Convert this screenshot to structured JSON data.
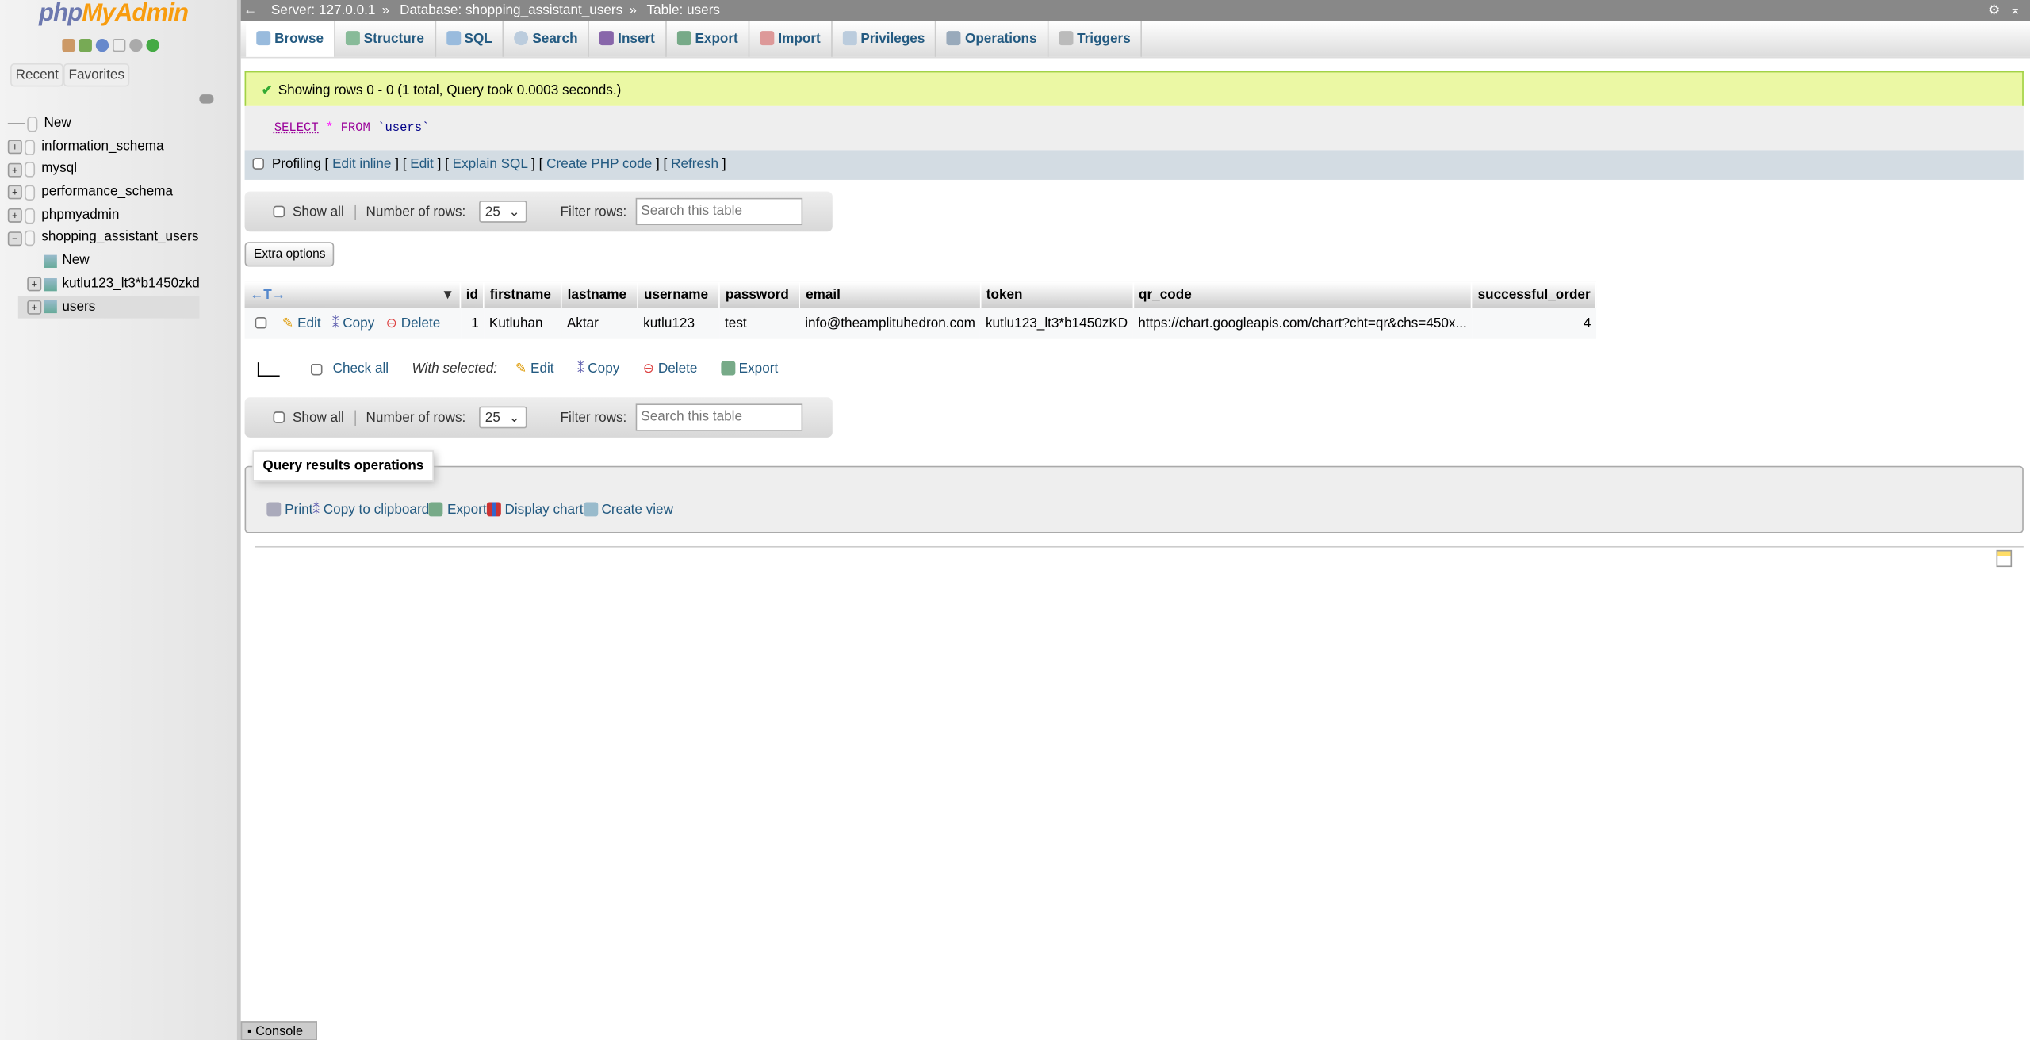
{
  "sidebar": {
    "logo": "phpMyAdmin",
    "logo_php": "php",
    "logo_myadmin": "MyAdmin",
    "recent": "Recent",
    "favorites": "Favorites",
    "tree": [
      {
        "label": "New"
      },
      {
        "label": "information_schema"
      },
      {
        "label": "mysql"
      },
      {
        "label": "performance_schema"
      },
      {
        "label": "phpmyadmin"
      },
      {
        "label": "shopping_assistant_users"
      }
    ],
    "subtree": [
      {
        "label": "New"
      },
      {
        "label": "kutlu123_lt3*b1450zkd"
      },
      {
        "label": "users"
      }
    ]
  },
  "breadcrumb": {
    "server": "Server: 127.0.0.1",
    "database": "Database: shopping_assistant_users",
    "table": "Table: users",
    "sep": "»"
  },
  "tabs": [
    "Browse",
    "Structure",
    "SQL",
    "Search",
    "Insert",
    "Export",
    "Import",
    "Privileges",
    "Operations",
    "Triggers"
  ],
  "message": "Showing rows 0 - 0 (1 total, Query took 0.0003 seconds.)",
  "sql": {
    "select": "SELECT",
    "star": "*",
    "from": "FROM",
    "table": "`users`"
  },
  "profiling": {
    "label": "Profiling",
    "links": [
      "Edit inline",
      "Edit",
      "Explain SQL",
      "Create PHP code",
      "Refresh"
    ]
  },
  "nav": {
    "show_all": "Show all",
    "num_rows_label": "Number of rows:",
    "num_rows": "25",
    "filter_label": "Filter rows:",
    "search_placeholder": "Search this table"
  },
  "extra_options": "Extra options",
  "table": {
    "columns": [
      "id",
      "firstname",
      "lastname",
      "username",
      "password",
      "email",
      "token",
      "qr_code",
      "successful_order"
    ],
    "rows": [
      {
        "actions": [
          "Edit",
          "Copy",
          "Delete"
        ],
        "cells": [
          "1",
          "Kutluhan",
          "Aktar",
          "kutlu123",
          "test",
          "info@theamplituhedron.com",
          "kutlu123_lt3*b1450zKD",
          "https://chart.googleapis.com/chart?cht=qr&chs=450x...",
          "4"
        ]
      }
    ]
  },
  "with_selected": {
    "check_all": "Check all",
    "label": "With selected:",
    "actions": [
      "Edit",
      "Copy",
      "Delete",
      "Export"
    ]
  },
  "query_ops": {
    "legend": "Query results operations",
    "items": [
      "Print",
      "Copy to clipboard",
      "Export",
      "Display chart",
      "Create view"
    ]
  },
  "console": "Console"
}
